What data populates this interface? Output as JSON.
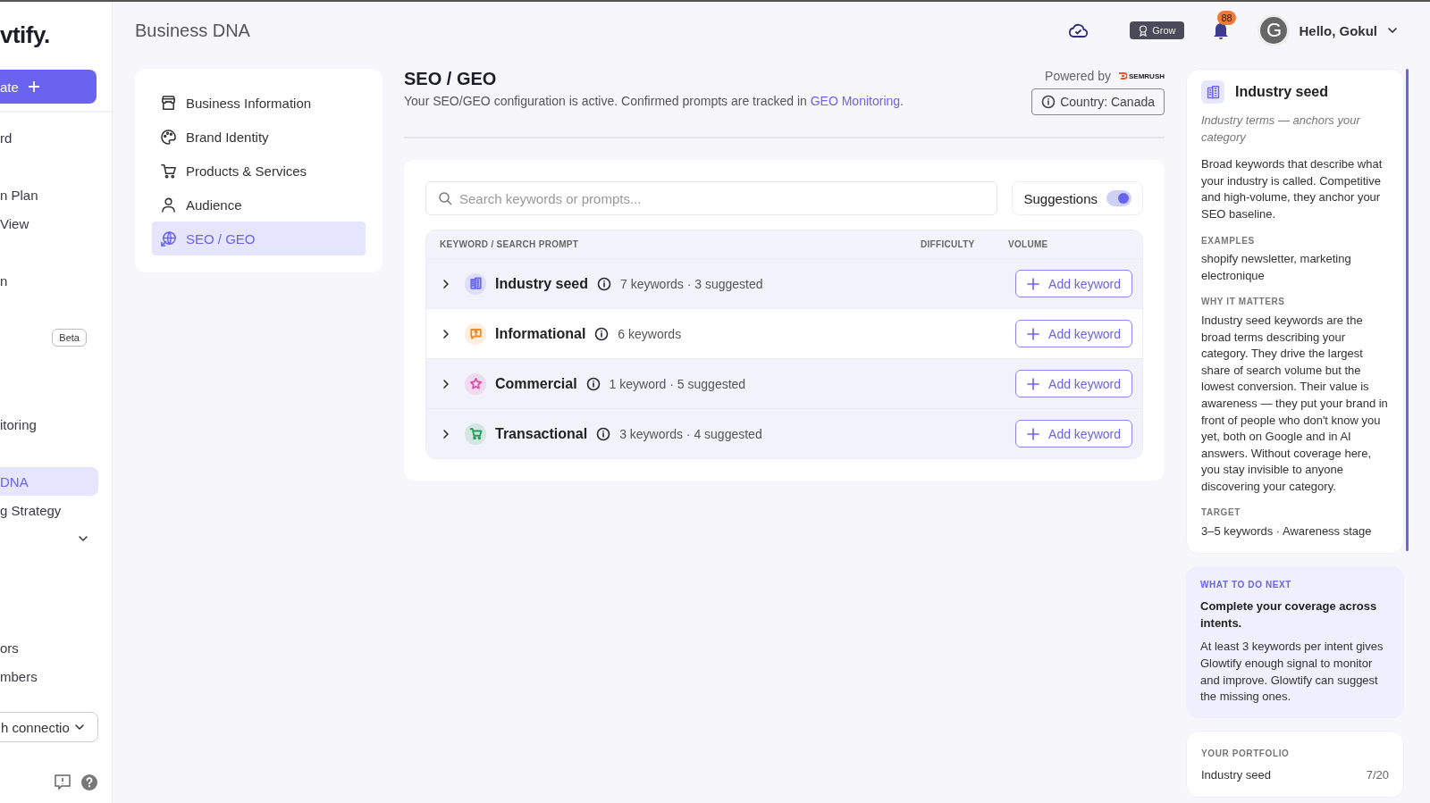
{
  "sidebar": {
    "logo": "vtify.",
    "create_button": "ate",
    "sections": [
      {
        "items": [
          {
            "label": "rd",
            "selected": false
          }
        ]
      },
      {
        "items": [
          {
            "label": "n Plan",
            "selected": false
          },
          {
            "label": "View",
            "selected": false
          }
        ]
      },
      {
        "items": [
          {
            "label": "n",
            "selected": false
          }
        ]
      },
      {
        "items": [
          {
            "badge": "Beta",
            "selected": false
          }
        ]
      },
      {
        "items": [
          {
            "label": "itoring",
            "selected": false
          }
        ]
      },
      {
        "items": [
          {
            "label": "DNA",
            "selected": true
          },
          {
            "label": "g Strategy",
            "selected": false
          },
          {
            "kind": "expander",
            "expanded": false,
            "selected": false
          }
        ]
      },
      {
        "items": [
          {
            "label": "ors",
            "selected": false
          },
          {
            "label": "mbers",
            "selected": false
          }
        ]
      }
    ],
    "connection_dropdown": "h connectio"
  },
  "topbar": {
    "title": "Business DNA",
    "grow_button": "Grow",
    "notifications": "88",
    "avatar": "G",
    "greeting": "Hello, Gokul"
  },
  "dna_nav": [
    {
      "label": "Business Information",
      "selected": false
    },
    {
      "label": "Brand Identity",
      "selected": false
    },
    {
      "label": "Products & Services",
      "selected": false
    },
    {
      "label": "Audience",
      "selected": false
    },
    {
      "label": "SEO / GEO",
      "selected": true
    }
  ],
  "seo": {
    "title": "SEO / GEO",
    "subtitle": "Your SEO/GEO configuration is active. Confirmed prompts are tracked in ",
    "subtitle_link": "GEO Monitoring",
    "subtitle_end": ".",
    "powered_by": "Powered by",
    "provider_logo": "SEMRUSH",
    "country_button": "Country: Canada",
    "search": {
      "placeholder": "Search keywords or prompts..."
    },
    "suggestions": {
      "label": "Suggestions",
      "on": true
    },
    "columns": [
      "KEYWORD / SEARCH PROMPT",
      "DIFFICULTY",
      "VOLUME"
    ],
    "rows": [
      {
        "name": "Industry seed",
        "summary": "7 keywords · 3 suggested",
        "color": "#6b6bf0",
        "expanded": false,
        "hovered": false,
        "button": "Add keyword"
      },
      {
        "name": "Informational",
        "summary": "6 keywords",
        "color": "#f08a24",
        "expanded": false,
        "hovered": true,
        "button": "Add keyword"
      },
      {
        "name": "Commercial",
        "summary": "1 keyword · 5 suggested",
        "color": "#e04fa8",
        "expanded": false,
        "hovered": false,
        "button": "Add keyword"
      },
      {
        "name": "Transactional",
        "summary": "3 keywords · 4 suggested",
        "color": "#22a05a",
        "expanded": false,
        "hovered": false,
        "button": "Add keyword"
      }
    ]
  },
  "info_panel": {
    "title": "Industry seed",
    "subtitle": "Industry terms — anchors your category",
    "description": "Broad keywords that describe what your industry is called. Competitive and high-volume, they anchor your SEO baseline.",
    "sections": [
      {
        "heading": "EXAMPLES",
        "text": "shopify newsletter, marketing electronique"
      },
      {
        "heading": "WHY IT MATTERS",
        "text": "Industry seed keywords are the broad terms describing your category. They drive the largest share of search volume but the lowest conversion. Their value is awareness — they put your brand in front of people who don't know you yet, both on Google and in AI answers. Without coverage here, you stay invisible to anyone discovering your category."
      },
      {
        "heading": "TARGET",
        "text": "3–5 keywords · Awareness stage"
      }
    ],
    "next": {
      "heading": "WHAT TO DO NEXT",
      "title": "Complete your coverage across intents.",
      "text": "At least 3 keywords per intent gives Glowtify enough signal to monitor and improve. Glowtify can suggest the missing ones."
    },
    "portfolio": {
      "heading": "YOUR PORTFOLIO",
      "rows": [
        {
          "label": "Industry seed",
          "value": "7/20"
        }
      ]
    }
  }
}
